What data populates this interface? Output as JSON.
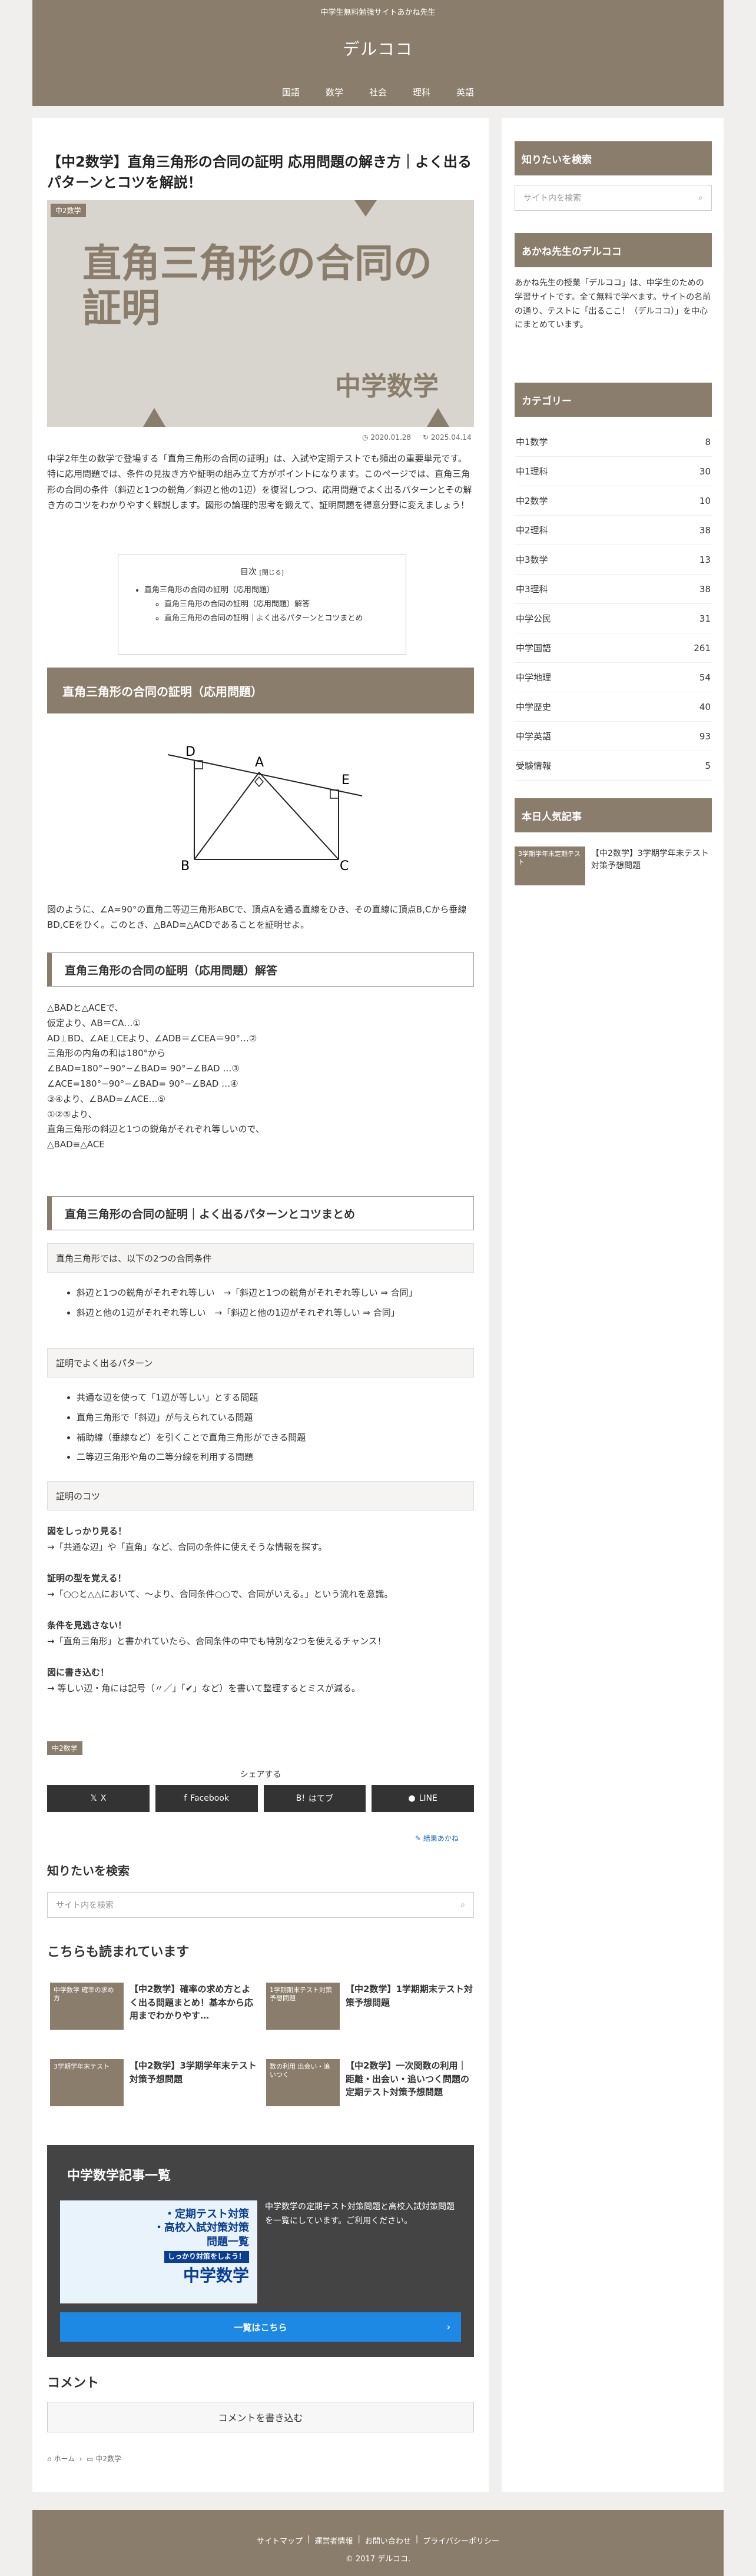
{
  "header": {
    "tagline": "中学生無料勉強サイトあかね先生",
    "logo": "デルココ",
    "nav": [
      "国語",
      "数学",
      "社会",
      "理科",
      "英語"
    ]
  },
  "article": {
    "title": "【中2数学】直角三角形の合同の証明 応用問題の解き方｜よく出るパターンとコツを解説！",
    "eyecatch": {
      "title": "直角三角形の合同の証明",
      "subject": "中学数学"
    },
    "category": "中2数学",
    "date_posted": "2020.01.28",
    "date_updated": "2025.04.14",
    "intro": "中学2年生の数学で登場する「直角三角形の合同の証明」は、入試や定期テストでも頻出の重要単元です。特に応用問題では、条件の見抜き方や証明の組み立て方がポイントになります。このページでは、直角三角形の合同の条件（斜辺と1つの鋭角／斜辺と他の1辺）を復習しつつ、応用問題でよく出るパターンとその解き方のコツをわかりやすく解説します。図形の論理的思考を鍛えて、証明問題を得意分野に変えましょう！",
    "toc": {
      "title": "目次",
      "toggle": "[閉じる]",
      "items": [
        "直角三角形の合同の証明（応用問題）",
        "直角三角形の合同の証明（応用問題）解答",
        "直角三角形の合同の証明｜よく出るパターンとコツまとめ"
      ]
    },
    "h2_1": "直角三角形の合同の証明（応用問題）",
    "diagram_labels": {
      "D": "D",
      "A": "A",
      "E": "E",
      "B": "B",
      "C": "C"
    },
    "problem": "図のように、∠A=90°の直角二等辺三角形ABCで、頂点Aを通る直線をひき、その直線に頂点B,Cから垂線BD,CEをひく。このとき、△BAD≡△ACDであることを証明せよ。",
    "h3_1": "直角三角形の合同の証明（応用問題）解答",
    "proof": [
      "△BADと△ACEで、",
      "仮定より、AB＝CA…①",
      "AD⊥BD、∠AE⊥CEより、∠ADB＝∠CEA＝90°…②",
      "三角形の内角の和は180°から",
      "∠BAD=180°−90°−∠BAD= 90°−∠BAD …③",
      "∠ACE=180°−90°−∠BAD= 90°−∠BAD …④",
      "③④より、∠BAD=∠ACE…⑤",
      "①②⑤より、",
      "直角三角形の斜辺と1つの鋭角がそれぞれ等しいので、",
      "△BAD≡△ACE"
    ],
    "h3_2": "直角三角形の合同の証明｜よく出るパターンとコツまとめ",
    "box1": "直角三角形では、以下の2つの合同条件",
    "list1": [
      "斜辺と1つの鋭角がそれぞれ等しい　→「斜辺と1つの鋭角がそれぞれ等しい ⇒ 合同」",
      "斜辺と他の1辺がそれぞれ等しい　→「斜辺と他の1辺がそれぞれ等しい ⇒ 合同」"
    ],
    "box2": "証明でよく出るパターン",
    "list2": [
      "共通な辺を使って「1辺が等しい」とする問題",
      "直角三角形で「斜辺」が与えられている問題",
      "補助線（垂線など）を引くことで直角三角形ができる問題",
      "二等辺三角形や角の二等分線を利用する問題"
    ],
    "box3": "証明のコツ",
    "tips": [
      {
        "head": "図をしっかり見る！",
        "body": "→「共通な辺」や「直角」など、合同の条件に使えそうな情報を探す。"
      },
      {
        "head": "証明の型を覚える！",
        "body": "→「○○と△△において、〜より、合同条件○○で、合同がいえる。」という流れを意識。"
      },
      {
        "head": "条件を見逃さない！",
        "body": "→「直角三角形」と書かれていたら、合同条件の中でも特別な2つを使えるチャンス！"
      },
      {
        "head": "図に書き込む！",
        "body": "→ 等しい辺・角には記号（〃／」「✔」など）を書いて整理するとミスが減る。"
      }
    ],
    "tag": "中2数学",
    "share_label": "シェアする",
    "share": [
      "X",
      "Facebook",
      "はてブ",
      "LINE"
    ],
    "author": "結果あかね"
  },
  "search": {
    "title": "知りたいを検索",
    "placeholder": "サイト内を検索"
  },
  "related": {
    "title": "こちらも読まれています",
    "items": [
      {
        "thumb": "中学数学 確率の求め方",
        "title": "【中2数学】確率の求め方とよく出る問題まとめ！基本から応用までわかりやす…"
      },
      {
        "thumb": "1学期期末テスト対策予想問題",
        "title": "【中2数学】1学期期末テスト対策予想問題"
      },
      {
        "thumb": "3学期学年末テスト",
        "title": "【中2数学】3学期学年末テスト対策予想問題"
      },
      {
        "thumb": "数の利用 出会い・追いつく",
        "title": "【中2数学】一次関数の利用｜距離・出会い・追いつく問題の定期テスト対策予想問題"
      }
    ]
  },
  "promo": {
    "title": "中学数学記事一覧",
    "img_lines": [
      "・定期テスト対策",
      "・高校入試対策対策",
      "問題一覧",
      "しっかり対策をしよう！",
      "中学数学"
    ],
    "desc": "中学数学の定期テスト対策問題と高校入試対策問題を一覧にしています。ご利用ください。",
    "button": "一覧はこちら"
  },
  "comment": {
    "title": "コメント",
    "button": "コメントを書き込む"
  },
  "breadcrumb": [
    "ホーム",
    "中2数学"
  ],
  "sidebar": {
    "search_title": "知りたいを検索",
    "search_placeholder": "サイト内を検索",
    "about_title": "あかね先生のデルココ",
    "about_text": "あかね先生の授業「デルココ」は、中学生のための学習サイトです。全て無料で学べます。サイトの名前の通り、テストに「出るここ！（デルココ）」を中心にまとめています。",
    "cat_title": "カテゴリー",
    "categories": [
      [
        "中1数学",
        "8"
      ],
      [
        "中1理科",
        "30"
      ],
      [
        "中2数学",
        "10"
      ],
      [
        "中2理科",
        "38"
      ],
      [
        "中3数学",
        "13"
      ],
      [
        "中3理科",
        "38"
      ],
      [
        "中学公民",
        "31"
      ],
      [
        "中学国語",
        "261"
      ],
      [
        "中学地理",
        "54"
      ],
      [
        "中学歴史",
        "40"
      ],
      [
        "中学英語",
        "93"
      ],
      [
        "受験情報",
        "5"
      ]
    ],
    "pop_title": "本日人気記事",
    "pop_item": "【中2数学】3学期学年末テスト対策予想問題",
    "pop_thumb": "3学期学年末定期テスト"
  },
  "footer": {
    "links": [
      "サイトマップ",
      "運営者情報",
      "お問い合わせ",
      "プライバシーポリシー"
    ],
    "copyright": "© 2017 デルココ."
  },
  "colors": {
    "brand": "#8b7d6b",
    "accent_blue": "#1e88e5",
    "dark": "#444444"
  }
}
